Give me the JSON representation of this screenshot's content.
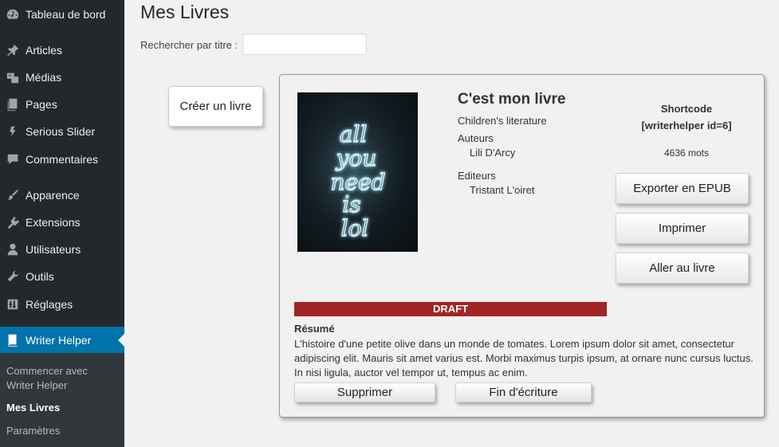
{
  "sidebar": {
    "items": [
      {
        "label": "Tableau de bord",
        "icon": "dashboard-icon"
      },
      {
        "label": "Articles",
        "icon": "pin-icon"
      },
      {
        "label": "Médias",
        "icon": "media-icon"
      },
      {
        "label": "Pages",
        "icon": "pages-icon"
      },
      {
        "label": "Serious Slider",
        "icon": "slider-icon"
      },
      {
        "label": "Commentaires",
        "icon": "comment-icon"
      },
      {
        "label": "Apparence",
        "icon": "brush-icon"
      },
      {
        "label": "Extensions",
        "icon": "plugin-icon"
      },
      {
        "label": "Utilisateurs",
        "icon": "user-icon"
      },
      {
        "label": "Outils",
        "icon": "wrench-icon"
      },
      {
        "label": "Réglages",
        "icon": "settings-icon"
      },
      {
        "label": "Writer Helper",
        "icon": "book-icon"
      }
    ],
    "submenu": [
      {
        "label": "Commencer avec\nWriter Helper"
      },
      {
        "label": "Mes Livres"
      },
      {
        "label": "Paramètres"
      }
    ]
  },
  "main": {
    "title": "Mes Livres",
    "search_label": "Rechercher par titre :",
    "search_value": "",
    "create_button": "Créer un livre"
  },
  "book": {
    "title": "C'est mon livre",
    "genre": "Children's literature",
    "authors_label": "Auteurs",
    "author": "Lili D'Arcy",
    "publishers_label": "Editeurs",
    "publisher": "Tristant L'oiret",
    "shortcode_label": "Shortcode",
    "shortcode_value": "[writerhelper id=6]",
    "word_count": "4636 mots",
    "export_button": "Exporter en EPUB",
    "print_button": "Imprimer",
    "goto_button": "Aller au livre",
    "status": "DRAFT",
    "status_color": "#a32424",
    "resume_label": "Résumé",
    "resume_text": "L'histoire d'une petite olive dans un monde de tomates. Lorem ipsum dolor sit amet, consectetur adipiscing elit. Mauris sit amet varius est. Morbi maximus turpis ipsum, at ornare nunc cursus luctus. In nisi ligula, auctor vel tempor ut, tempus ac enim.",
    "delete_button": "Supprimer",
    "finish_button": "Fin d'écriture",
    "cover_text": [
      "all",
      "you",
      "need",
      "is",
      "lol"
    ]
  },
  "colors": {
    "sidebar_bg": "#23282d",
    "active_bg": "#0073aa",
    "submenu_bg": "#32373c"
  }
}
